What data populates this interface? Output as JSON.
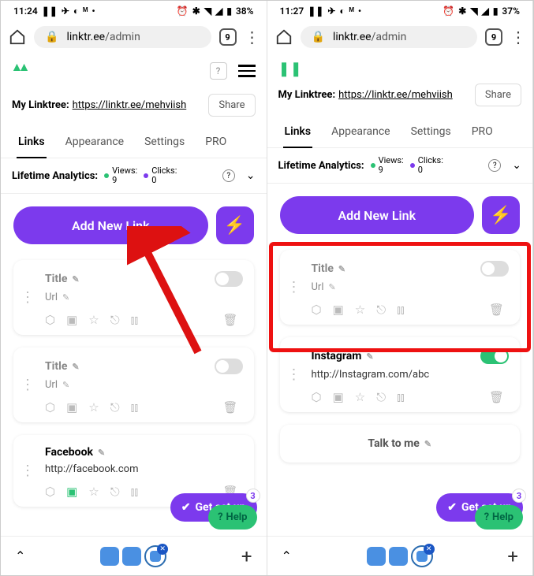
{
  "status": {
    "time1": "11:24",
    "time2": "11:27",
    "battery1": "38%",
    "battery2": "37%"
  },
  "browser": {
    "url_prefix": "linktr.ee",
    "url_suffix": "/admin",
    "tab_count": "9"
  },
  "mylinktree": {
    "label": "My Linktree:",
    "url": "https://linktr.ee/mehviish",
    "share": "Share"
  },
  "tabs": [
    "Links",
    "Appearance",
    "Settings",
    "PRO"
  ],
  "analytics": {
    "label": "Lifetime Analytics:",
    "views_label": "Views:",
    "views_value": "9",
    "clicks_label": "Clicks:",
    "clicks_value": "0"
  },
  "add_button": "Add New Link",
  "card_placeholder": {
    "title": "Title",
    "url": "Url"
  },
  "cards_left": [
    {
      "title": "Title",
      "url": "Url",
      "filled": false,
      "on": false
    },
    {
      "title": "Title",
      "url": "Url",
      "filled": false,
      "on": false
    },
    {
      "title": "Facebook",
      "url": "http://facebook.com",
      "filled": true,
      "on": false
    }
  ],
  "cards_right": [
    {
      "title": "Title",
      "url": "Url",
      "filled": false,
      "on": false
    },
    {
      "title": "Instagram",
      "url": "http://Instagram.com/abc",
      "filled": true,
      "on": true
    }
  ],
  "talk_to_me": "Talk to me",
  "get_set_up": "Get set up",
  "get_set_up_badge": "3",
  "help": "Help"
}
